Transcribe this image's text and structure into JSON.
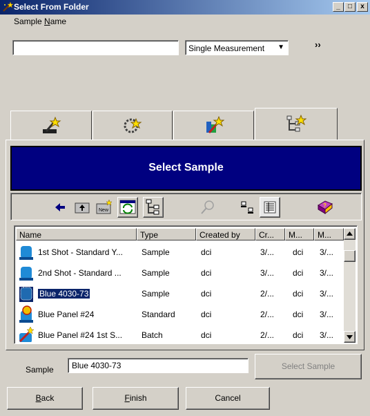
{
  "window": {
    "title": "Select From Folder",
    "buttons": [
      "_",
      "□",
      "x"
    ]
  },
  "sample_name": {
    "label_prefix": "Sample ",
    "label_accel": "N",
    "label_suffix": "ame",
    "value": "",
    "measurement_type": "Single Measurement",
    "expand_label": "››"
  },
  "tabs": [
    {
      "icon": "select-wand-icon",
      "selected": false
    },
    {
      "icon": "sparkle-wand-icon",
      "selected": false
    },
    {
      "icon": "color-wand-icon",
      "selected": false
    },
    {
      "icon": "tree-wand-icon",
      "selected": true
    }
  ],
  "header": {
    "title": "Select Sample"
  },
  "toolbar": {
    "icons": [
      "back-arrow-icon",
      "up-folder-icon",
      "new-folder-icon",
      "refresh-view-icon",
      "tree-view-icon",
      "search-icon",
      "small-icons-icon",
      "details-view-icon",
      "help-book-icon"
    ]
  },
  "list": {
    "columns": [
      "Name",
      "Type",
      "Created by",
      "Cr...",
      "M...",
      "M..."
    ],
    "rows": [
      {
        "name": "1st Shot - Standard Y...",
        "type": "Sample",
        "created_by": "dci",
        "cr": "3/...",
        "m1": "dci",
        "m2": "3/...",
        "icon": "sample-icon"
      },
      {
        "name": "2nd Shot - Standard ...",
        "type": "Sample",
        "created_by": "dci",
        "cr": "3/...",
        "m1": "dci",
        "m2": "3/...",
        "icon": "sample-icon"
      },
      {
        "name": "Blue 4030-73",
        "type": "Sample",
        "created_by": "dci",
        "cr": "2/...",
        "m1": "dci",
        "m2": "3/...",
        "icon": "sample-icon",
        "selected": true
      },
      {
        "name": "Blue Panel #24",
        "type": "Standard",
        "created_by": "dci",
        "cr": "2/...",
        "m1": "dci",
        "m2": "3/...",
        "icon": "standard-icon"
      },
      {
        "name": "Blue Panel #24 1st S...",
        "type": "Batch",
        "created_by": "dci",
        "cr": "2/...",
        "m1": "dci",
        "m2": "3/...",
        "icon": "batch-icon"
      }
    ]
  },
  "bottom": {
    "sample_label": "Sample",
    "sample_value": "Blue 4030-73",
    "select_button": "Select Sample",
    "back_accel": "B",
    "back_rest": "ack",
    "finish_accel": "F",
    "finish_rest": "inish",
    "cancel": "Cancel"
  },
  "colors": {
    "title_start": "#0a246a",
    "title_end": "#a6caf0",
    "header_band": "#000080",
    "face": "#d4d0c8"
  }
}
